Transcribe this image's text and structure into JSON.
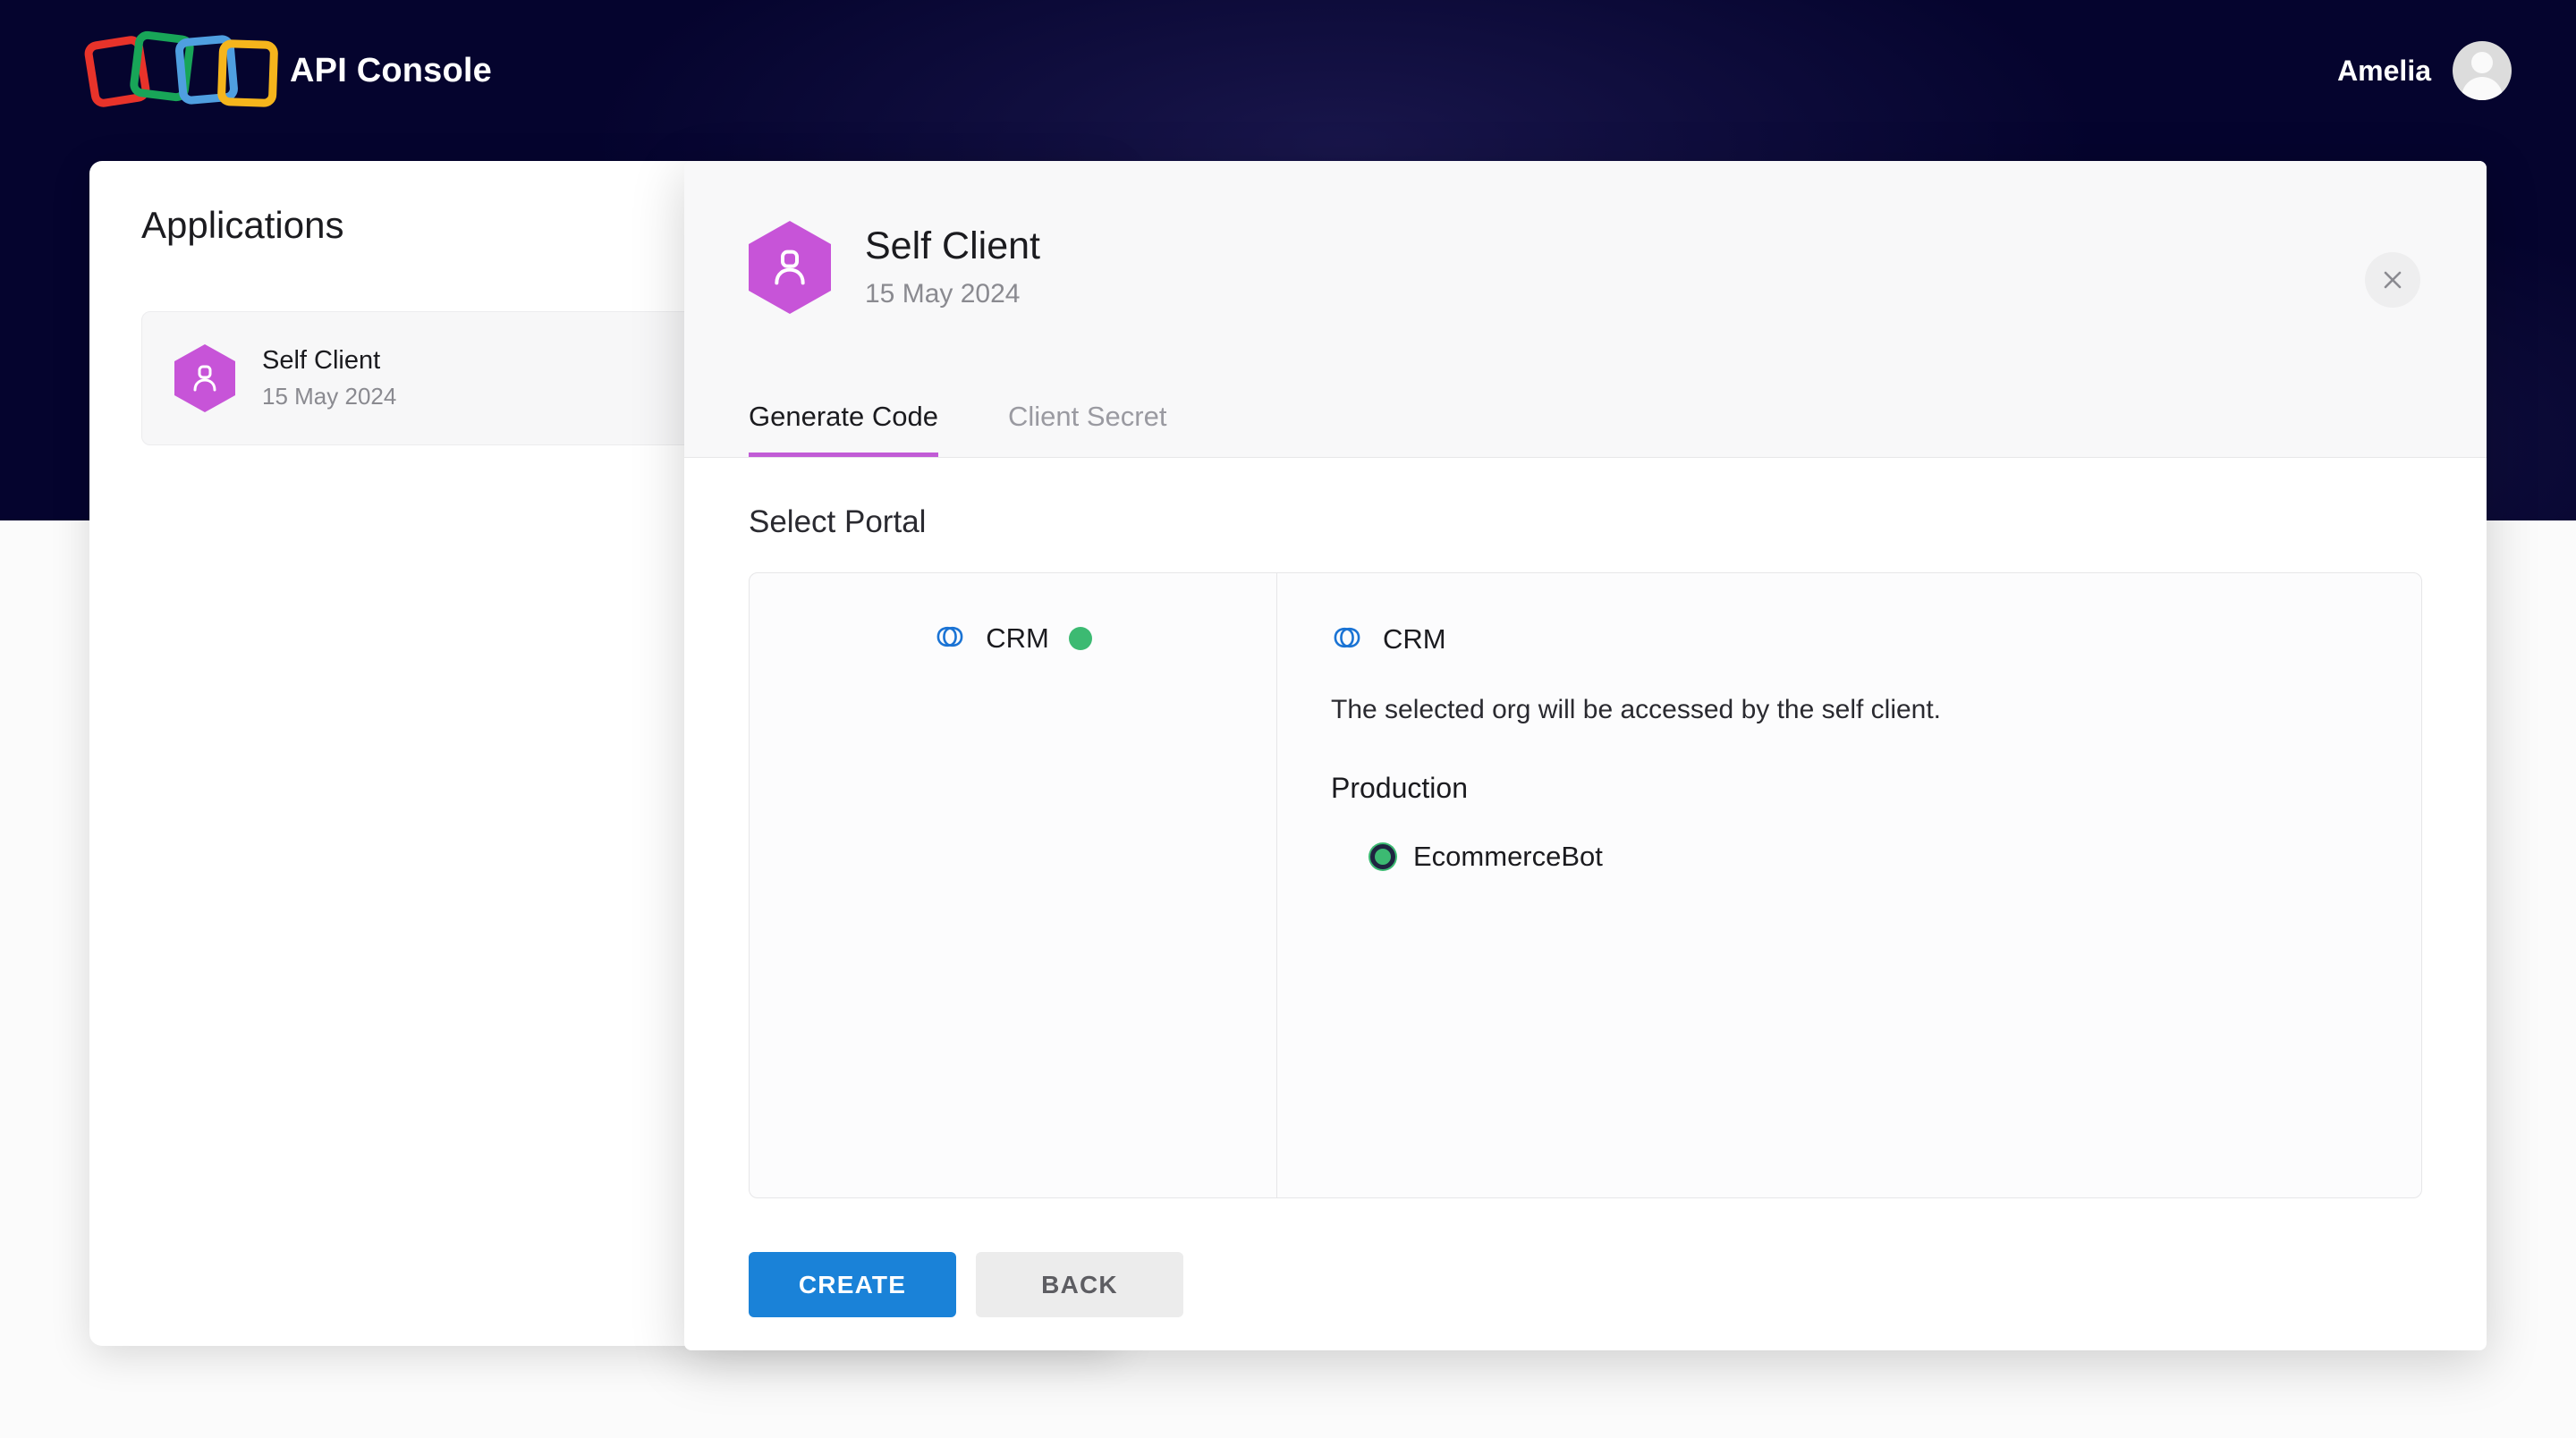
{
  "header": {
    "brand_title": "API Console",
    "logo_icon": "four-squares-logo-icon",
    "user_name": "Amelia",
    "avatar_icon": "user-avatar-icon"
  },
  "applications_panel": {
    "title": "Applications",
    "items": [
      {
        "name": "Self Client",
        "date": "15 May 2024",
        "icon": "person-hexagon-icon"
      }
    ]
  },
  "modal": {
    "icon": "person-hexagon-icon",
    "title": "Self Client",
    "subtitle": "15 May 2024",
    "close_icon": "close-icon",
    "tabs": [
      {
        "label": "Generate Code",
        "active": true
      },
      {
        "label": "Client Secret",
        "active": false
      }
    ],
    "section_title": "Select Portal",
    "portal_list": [
      {
        "name": "CRM",
        "icon": "zoho-crm-icon",
        "status_icon": "green-status-dot",
        "selected": true
      }
    ],
    "portal_detail": {
      "icon": "zoho-crm-icon",
      "title": "CRM",
      "description": "The selected org will be accessed by the self client.",
      "environment_label": "Production",
      "orgs": [
        {
          "name": "EcommerceBot",
          "selected": true,
          "icon": "radio-selected-icon"
        }
      ]
    },
    "buttons": {
      "primary": "CREATE",
      "secondary": "BACK"
    }
  },
  "colors": {
    "header_bg": "#05042e",
    "accent_purple": "#c15cd6",
    "hex_icon": "#c754d8",
    "primary_button": "#1a82d8",
    "secondary_button": "#ececec",
    "status_green": "#3cba72",
    "crm_blue": "#1a73d4"
  }
}
